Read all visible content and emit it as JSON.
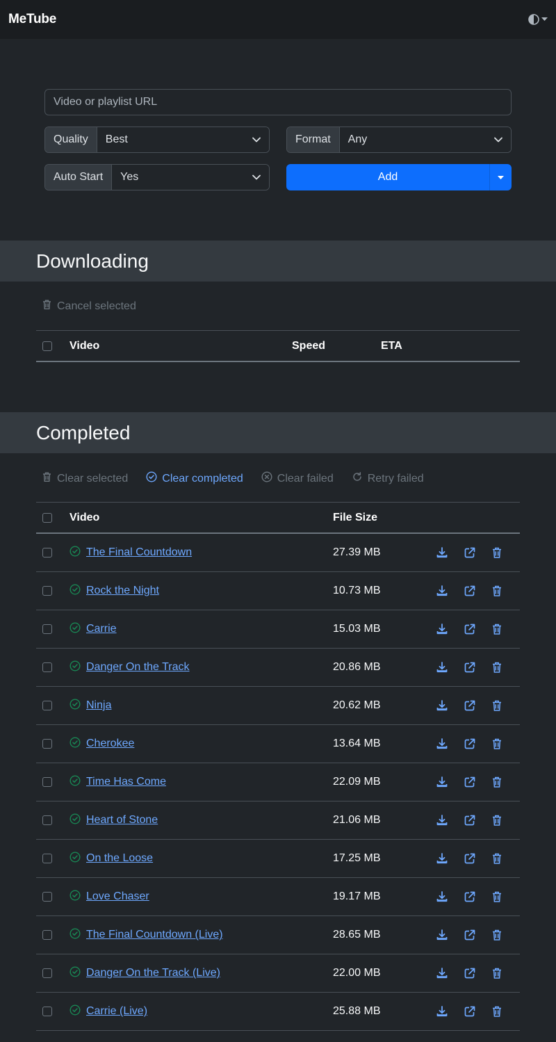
{
  "app": {
    "title": "MeTube"
  },
  "form": {
    "url_placeholder": "Video or playlist URL",
    "quality_label": "Quality",
    "quality_value": "Best",
    "format_label": "Format",
    "format_value": "Any",
    "autostart_label": "Auto Start",
    "autostart_value": "Yes",
    "add_label": "Add"
  },
  "downloading": {
    "title": "Downloading",
    "cancel_label": "Cancel selected",
    "columns": {
      "video": "Video",
      "speed": "Speed",
      "eta": "ETA"
    }
  },
  "completed": {
    "title": "Completed",
    "actions": {
      "clear_selected": "Clear selected",
      "clear_completed": "Clear completed",
      "clear_failed": "Clear failed",
      "retry_failed": "Retry failed"
    },
    "columns": {
      "video": "Video",
      "size": "File Size"
    },
    "rows": [
      {
        "title": "The Final Countdown",
        "size": "27.39 MB"
      },
      {
        "title": "Rock the Night",
        "size": "10.73 MB"
      },
      {
        "title": "Carrie",
        "size": "15.03 MB"
      },
      {
        "title": "Danger On the Track",
        "size": "20.86 MB"
      },
      {
        "title": "Ninja",
        "size": "20.62 MB"
      },
      {
        "title": "Cherokee",
        "size": "13.64 MB"
      },
      {
        "title": "Time Has Come",
        "size": "22.09 MB"
      },
      {
        "title": "Heart of Stone",
        "size": "21.06 MB"
      },
      {
        "title": "On the Loose",
        "size": "17.25 MB"
      },
      {
        "title": "Love Chaser",
        "size": "19.17 MB"
      },
      {
        "title": "The Final Countdown (Live)",
        "size": "28.65 MB"
      },
      {
        "title": "Danger On the Track (Live)",
        "size": "22.00 MB"
      },
      {
        "title": "Carrie (Live)",
        "size": "25.88 MB"
      }
    ]
  },
  "colors": {
    "accent": "#0d6efd",
    "link": "#6ea8fe",
    "success": "#198754",
    "background": "#212529"
  }
}
